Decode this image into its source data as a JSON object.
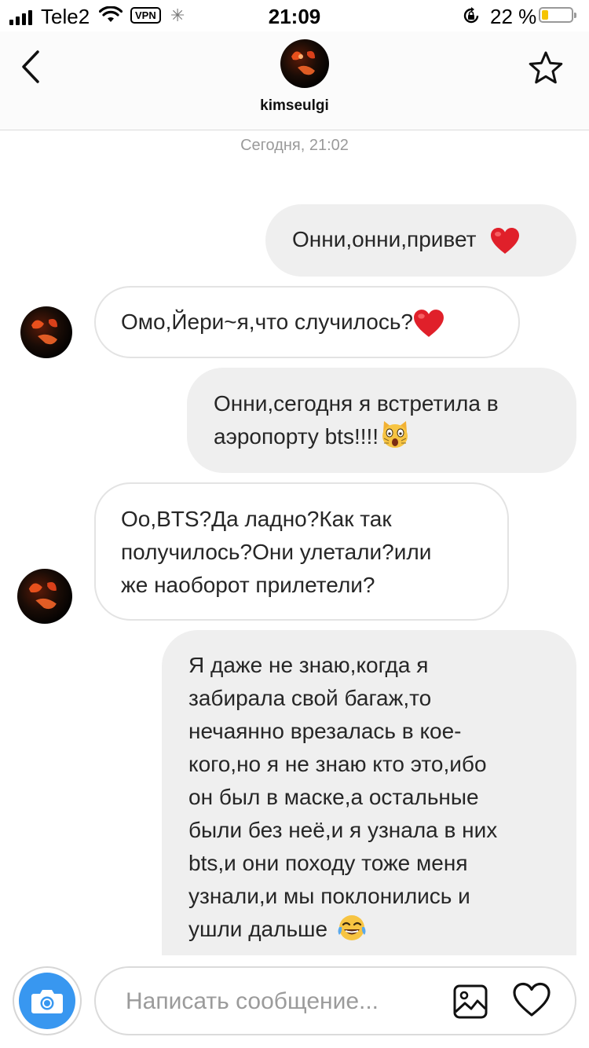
{
  "status_bar": {
    "carrier": "Tele2",
    "vpn": "VPN",
    "time": "21:09",
    "battery_percent": "22 %",
    "battery_level": 0.22,
    "battery_color": "#f5c400"
  },
  "header": {
    "username": "kimseulgi",
    "icons": [
      "chevron-left-icon",
      "star-icon"
    ]
  },
  "thread": {
    "date_separator": "Сегодня, 21:02",
    "messages": [
      {
        "direction": "out",
        "lines": [
          "Онни,онни,привет"
        ],
        "emoji": "red-heart"
      },
      {
        "direction": "in",
        "lines": [
          "Омо,Йери~я,что случилось?"
        ],
        "emoji": "red-heart"
      },
      {
        "direction": "out",
        "lines": [
          "Онни,сегодня я встретила в",
          "аэропорту bts!!!!"
        ],
        "emoji": "weary-cat"
      },
      {
        "direction": "in",
        "lines": [
          "Оо,BTS?Да ладно?Как так",
          "получилось?Они улетали?или",
          "же наоборот прилетели?"
        ]
      },
      {
        "direction": "out",
        "lines": [
          "Я даже не знаю,когда я",
          "забирала свой багаж,то",
          "нечаянно врезалась в кое-",
          "кого,но я не знаю кто это,ибо",
          "он был в маске,а остальные",
          "были без неё,и я узнала в них",
          "bts,и они походу тоже меня",
          "узнали,и мы поклонились и",
          "ушли дальше"
        ],
        "emoji": "tears-of-joy"
      }
    ]
  },
  "composer": {
    "placeholder": "Написать сообщение...",
    "value": "",
    "icons": [
      "camera-icon",
      "gallery-icon",
      "heart-icon"
    ],
    "accent_color": "#3897f0"
  }
}
